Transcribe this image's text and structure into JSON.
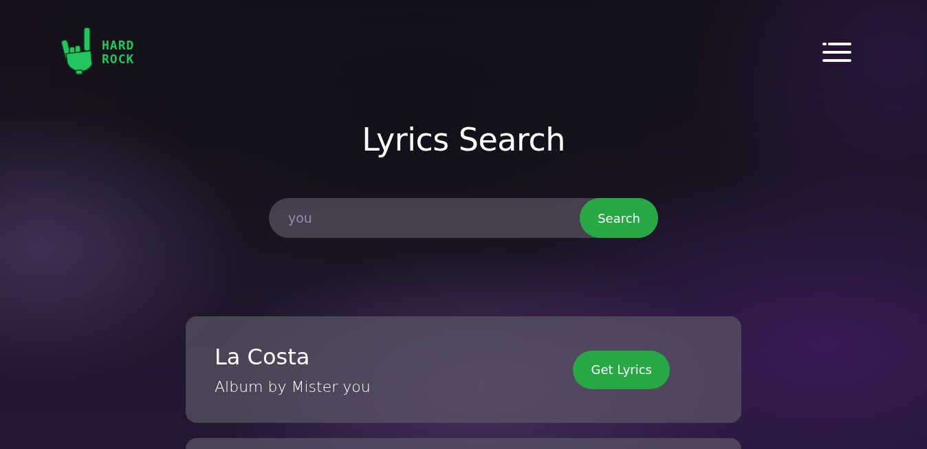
{
  "logo": {
    "line_1": "HARD",
    "line_2": "ROCK"
  },
  "title": "Lyrics Search",
  "search": {
    "placeholder": "you",
    "button": "Search"
  },
  "results": [
    {
      "title": "La Costa",
      "subtitle": "Album by Mister you",
      "button": "Get Lyrics"
    }
  ]
}
